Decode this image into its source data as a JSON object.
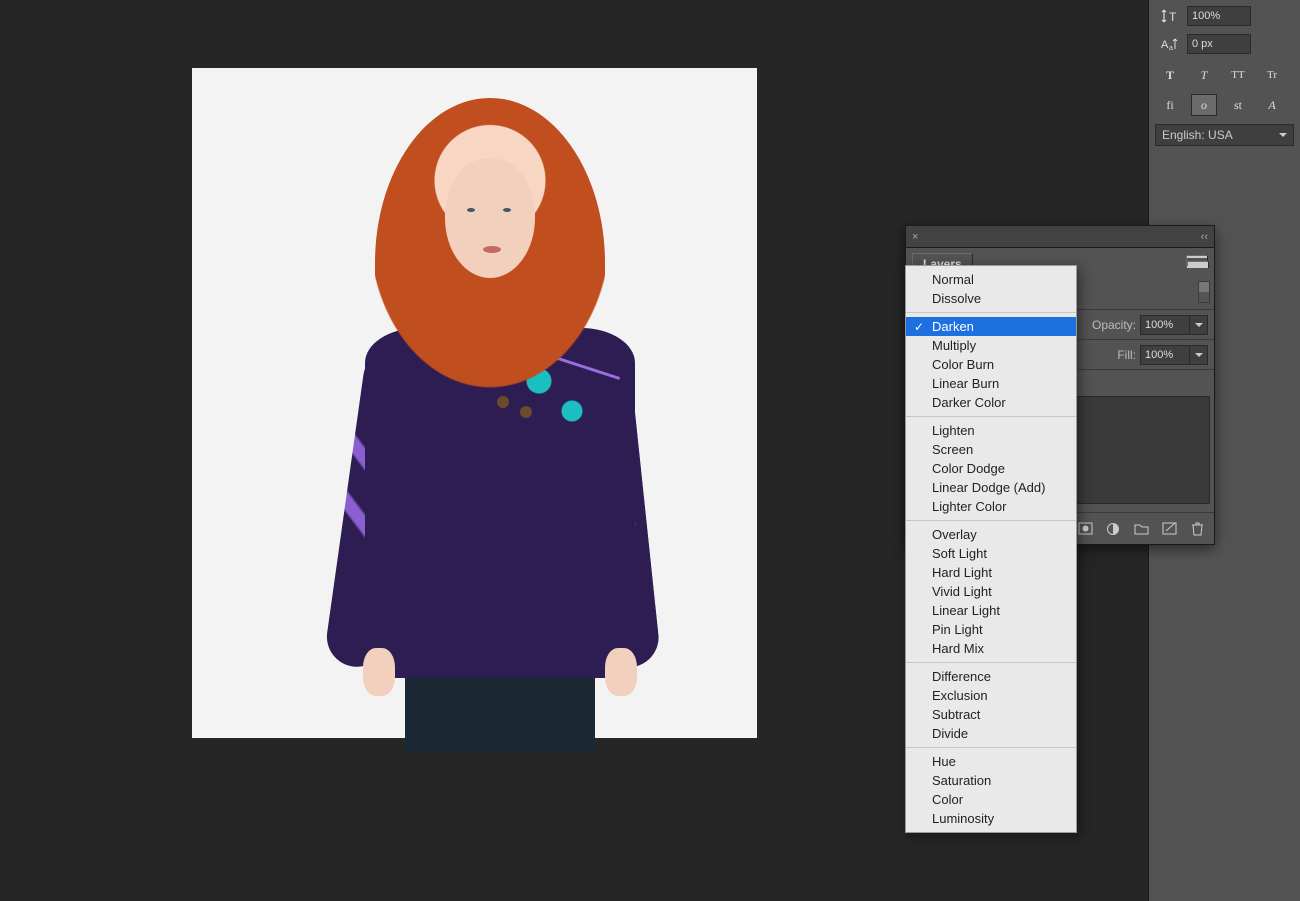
{
  "char_panel": {
    "vscale_value": "100%",
    "baseline_value": "0 px",
    "style_buttons": [
      "T",
      "T",
      "TT",
      "Tr"
    ],
    "feature_buttons": [
      "fi",
      "o",
      "st",
      "A"
    ],
    "language": "English: USA"
  },
  "layers_panel": {
    "title": "Layers",
    "opacity_label": "Opacity:",
    "opacity_value": "100%",
    "fill_label": "Fill:",
    "fill_value": "100%"
  },
  "blend_menu": {
    "groups": [
      [
        "Normal",
        "Dissolve"
      ],
      [
        "Darken",
        "Multiply",
        "Color Burn",
        "Linear Burn",
        "Darker Color"
      ],
      [
        "Lighten",
        "Screen",
        "Color Dodge",
        "Linear Dodge (Add)",
        "Lighter Color"
      ],
      [
        "Overlay",
        "Soft Light",
        "Hard Light",
        "Vivid Light",
        "Linear Light",
        "Pin Light",
        "Hard Mix"
      ],
      [
        "Difference",
        "Exclusion",
        "Subtract",
        "Divide"
      ],
      [
        "Hue",
        "Saturation",
        "Color",
        "Luminosity"
      ]
    ],
    "selected": "Darken"
  }
}
